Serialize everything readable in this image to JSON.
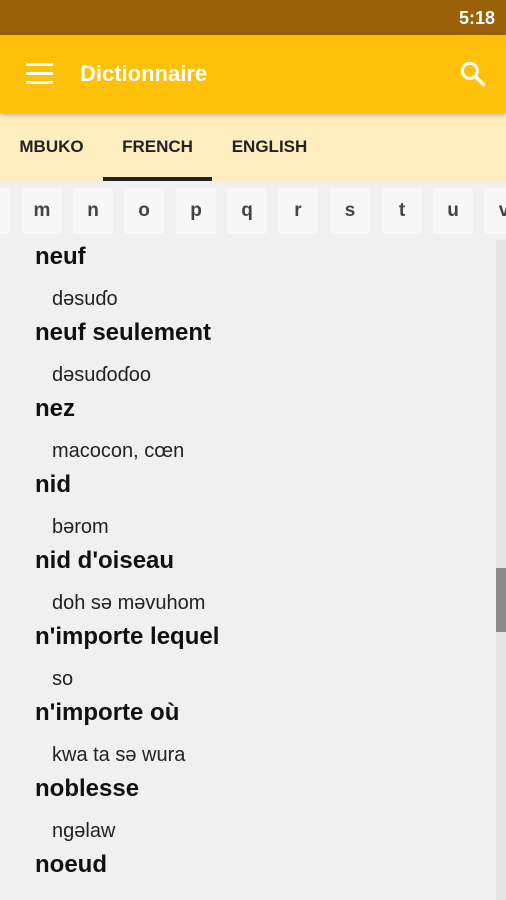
{
  "status_bar": {
    "time": "5:18"
  },
  "app_bar": {
    "title": "Dictionnaire"
  },
  "tabs": [
    {
      "label": "MBUKO",
      "selected": false
    },
    {
      "label": "FRENCH",
      "selected": true
    },
    {
      "label": "ENGLISH",
      "selected": false
    }
  ],
  "alphabet": [
    "l",
    "m",
    "n",
    "o",
    "p",
    "q",
    "r",
    "s",
    "t",
    "u",
    "v"
  ],
  "entries": [
    {
      "word": "neuf",
      "translation": "dəsuɗo"
    },
    {
      "word": "neuf seulement",
      "translation": "dəsuɗoɗoo"
    },
    {
      "word": "nez",
      "translation": "macocon, cœn"
    },
    {
      "word": "nid",
      "translation": "bərom"
    },
    {
      "word": "nid d'oiseau",
      "translation": "doh sə məvuhom"
    },
    {
      "word": "n'importe lequel",
      "translation": "so"
    },
    {
      "word": "n'importe où",
      "translation": "kwa ta sə wura"
    },
    {
      "word": "noblesse",
      "translation": "ngəlaw"
    },
    {
      "word": "noeud",
      "translation": ""
    }
  ],
  "scroll": {
    "position": 0.55
  },
  "colors": {
    "status_bar": "#9a6108",
    "app_bar": "#ffc107",
    "tab_strip": "#ffedbf",
    "tab_indicator": "#222222"
  }
}
